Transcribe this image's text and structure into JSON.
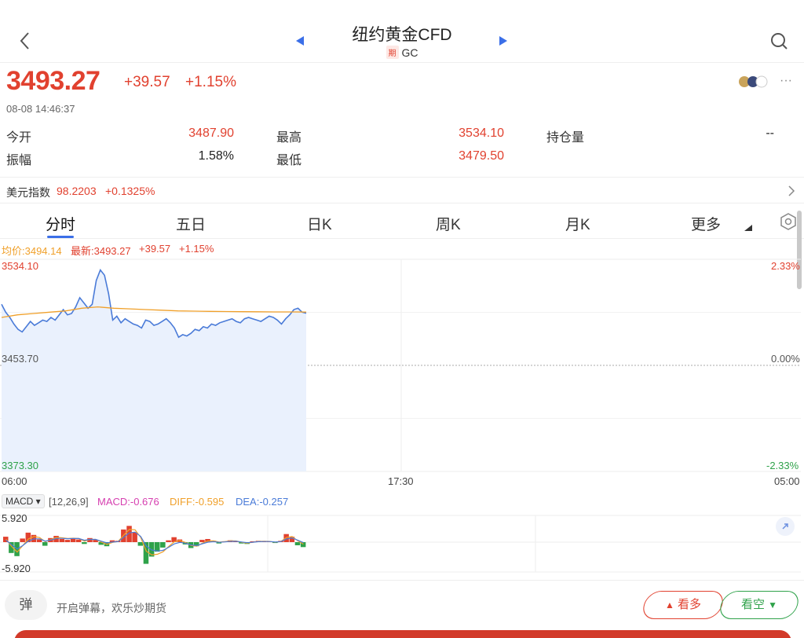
{
  "header": {
    "title": "纽约黄金CFD",
    "badge": "期",
    "code": "GC"
  },
  "quote": {
    "price": "3493.27",
    "change": "+39.57",
    "change_pct": "+1.15%",
    "timestamp": "08-08 14:46:37",
    "more": "···"
  },
  "stats": {
    "open_label": "今开",
    "open_value": "3487.90",
    "high_label": "最高",
    "high_value": "3534.10",
    "oi_label": "持仓量",
    "oi_value": "--",
    "amp_label": "振幅",
    "amp_value": "1.58%",
    "low_label": "最低",
    "low_value": "3479.50"
  },
  "usd_index": {
    "label": "美元指数",
    "value": "98.2203",
    "change": "+0.1325%"
  },
  "tabs": [
    "分时",
    "五日",
    "日K",
    "周K",
    "月K",
    "更多"
  ],
  "legend": {
    "avg": "均价:3494.14",
    "latest": "最新:3493.27",
    "change": "+39.57",
    "pct": "+1.15%"
  },
  "chart_data": [
    {
      "type": "line",
      "y_left_ticks": [
        "3534.10",
        "3453.70",
        "3373.30"
      ],
      "y_right_ticks": [
        "2.33%",
        "0.00%",
        "-2.33%"
      ],
      "x_ticks": [
        "06:00",
        "17:30",
        "05:00"
      ],
      "ylim": [
        3373.3,
        3534.1
      ],
      "baseline": 3453.7,
      "series": [
        {
          "values": [
            3500,
            3494,
            3490,
            3485,
            3481,
            3479,
            3483,
            3487,
            3484,
            3486,
            3488,
            3487,
            3490,
            3488,
            3492,
            3496,
            3492,
            3493,
            3498,
            3505,
            3501,
            3497,
            3500,
            3518,
            3526,
            3522,
            3508,
            3488,
            3491,
            3486,
            3489,
            3487,
            3485,
            3484,
            3482,
            3488,
            3487,
            3484,
            3485,
            3487,
            3489,
            3486,
            3482,
            3475,
            3477,
            3476,
            3478,
            3481,
            3480,
            3483,
            3482,
            3485,
            3484,
            3486,
            3487,
            3488,
            3489,
            3487,
            3486,
            3489,
            3490,
            3489,
            3488,
            3487,
            3489,
            3491,
            3490,
            3488,
            3485,
            3489,
            3492,
            3496,
            3497,
            3494,
            3493.27
          ],
          "color": "#4a7bd8"
        },
        {
          "values": [
            3490,
            3492,
            3493,
            3494,
            3495,
            3497,
            3498,
            3497,
            3496.5,
            3496,
            3495.5,
            3495,
            3494.8,
            3494.6,
            3494.5,
            3494.4,
            3494.3,
            3494.2,
            3494.2,
            3494.14
          ],
          "color": "#f0a02a"
        }
      ]
    },
    {
      "type": "bar",
      "name": "MACD",
      "y_ticks": [
        "5.920",
        "0.000",
        "-5.920"
      ],
      "ylim": [
        -5.92,
        5.92
      ],
      "values": [
        1.2,
        -2.4,
        -3.1,
        0.8,
        2.1,
        1.6,
        0.6,
        -0.8,
        0.9,
        1.4,
        0.7,
        0.5,
        0.8,
        0.6,
        -0.4,
        0.9,
        0.5,
        -0.6,
        -0.9,
        0.4,
        0.3,
        2.8,
        3.6,
        2.2,
        -0.8,
        -4.8,
        -3.2,
        -2.1,
        -1.2,
        0.4,
        1.1,
        0.6,
        -0.5,
        -1.3,
        -0.9,
        0.5,
        0.7,
        0.3,
        -0.3,
        0.2,
        0.4,
        0.2,
        -0.3,
        -0.4,
        0.2,
        0.3,
        0.2,
        0.1,
        -0.2,
        0.3,
        1.8,
        1.2,
        -0.7,
        -1.1
      ],
      "line_series": [
        {
          "name": "DIFF",
          "value": "-0.595",
          "color": "#f0a02a"
        },
        {
          "name": "DEA",
          "value": "-0.257",
          "color": "#4a7bd8"
        }
      ]
    }
  ],
  "macd": {
    "selector": "MACD",
    "params": "[12,26,9]",
    "macd_text": "MACD:-0.676",
    "diff_text": "DIFF:-0.595",
    "dea_text": "DEA:-0.257"
  },
  "bottom": {
    "danmu_icon": "弹",
    "danmu_text": "开启弹幕，欢乐炒期货",
    "long_label": "看多",
    "short_label": "看空"
  },
  "colors": {
    "up": "#e1412f",
    "down": "#2fa24a",
    "accent": "#3b6fe8"
  },
  "icons": [
    "back-icon",
    "search-icon",
    "prev-arrow-icon",
    "next-arrow-icon",
    "chevron-right-icon",
    "settings-icon",
    "expand-icon",
    "flame-icon",
    "chevron-down-icon"
  ]
}
